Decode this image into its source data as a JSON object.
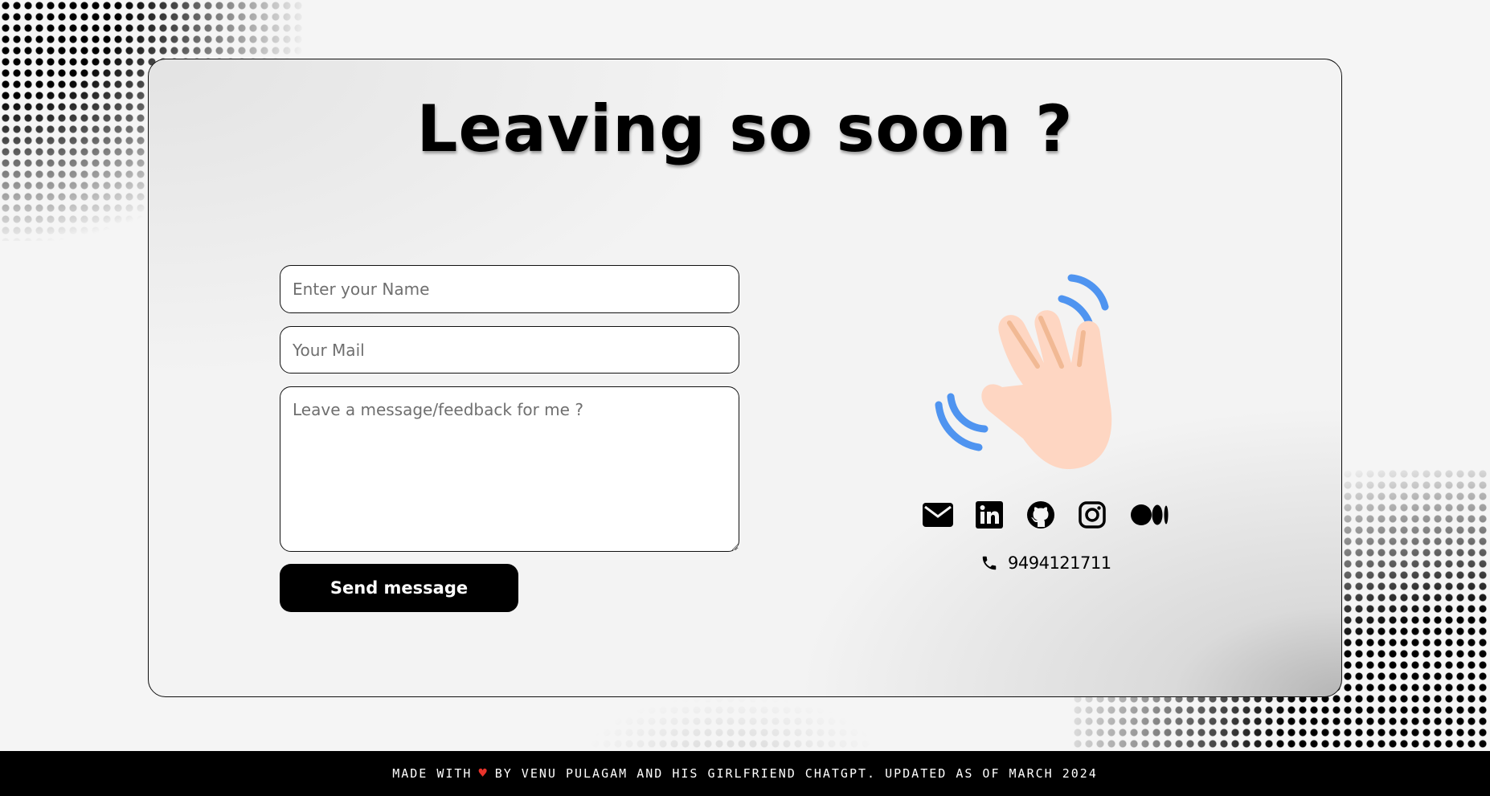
{
  "title": "Leaving so soon ?",
  "form": {
    "name_placeholder": "Enter your Name",
    "mail_placeholder": "Your Mail",
    "message_placeholder": "Leave a message/feedback for me ?",
    "send_label": "Send message"
  },
  "illustration": {
    "icon": "waving-hand-icon",
    "skin_color": "#fed6c2",
    "wave_color": "#4f94f0"
  },
  "socials": [
    {
      "icon": "mail-icon"
    },
    {
      "icon": "linkedin-icon"
    },
    {
      "icon": "github-icon"
    },
    {
      "icon": "instagram-icon"
    },
    {
      "icon": "medium-icon"
    }
  ],
  "contact": {
    "icon": "phone-icon",
    "phone": "9494121711"
  },
  "footer": {
    "before_heart": "Made with",
    "heart": "♥",
    "after_heart": "by Venu Pulagam and his girlfriend ChatGPT. Updated as of March 2024"
  },
  "colors": {
    "accent": "#000000",
    "background": "#f5f5f5",
    "heart": "#e8332b"
  }
}
